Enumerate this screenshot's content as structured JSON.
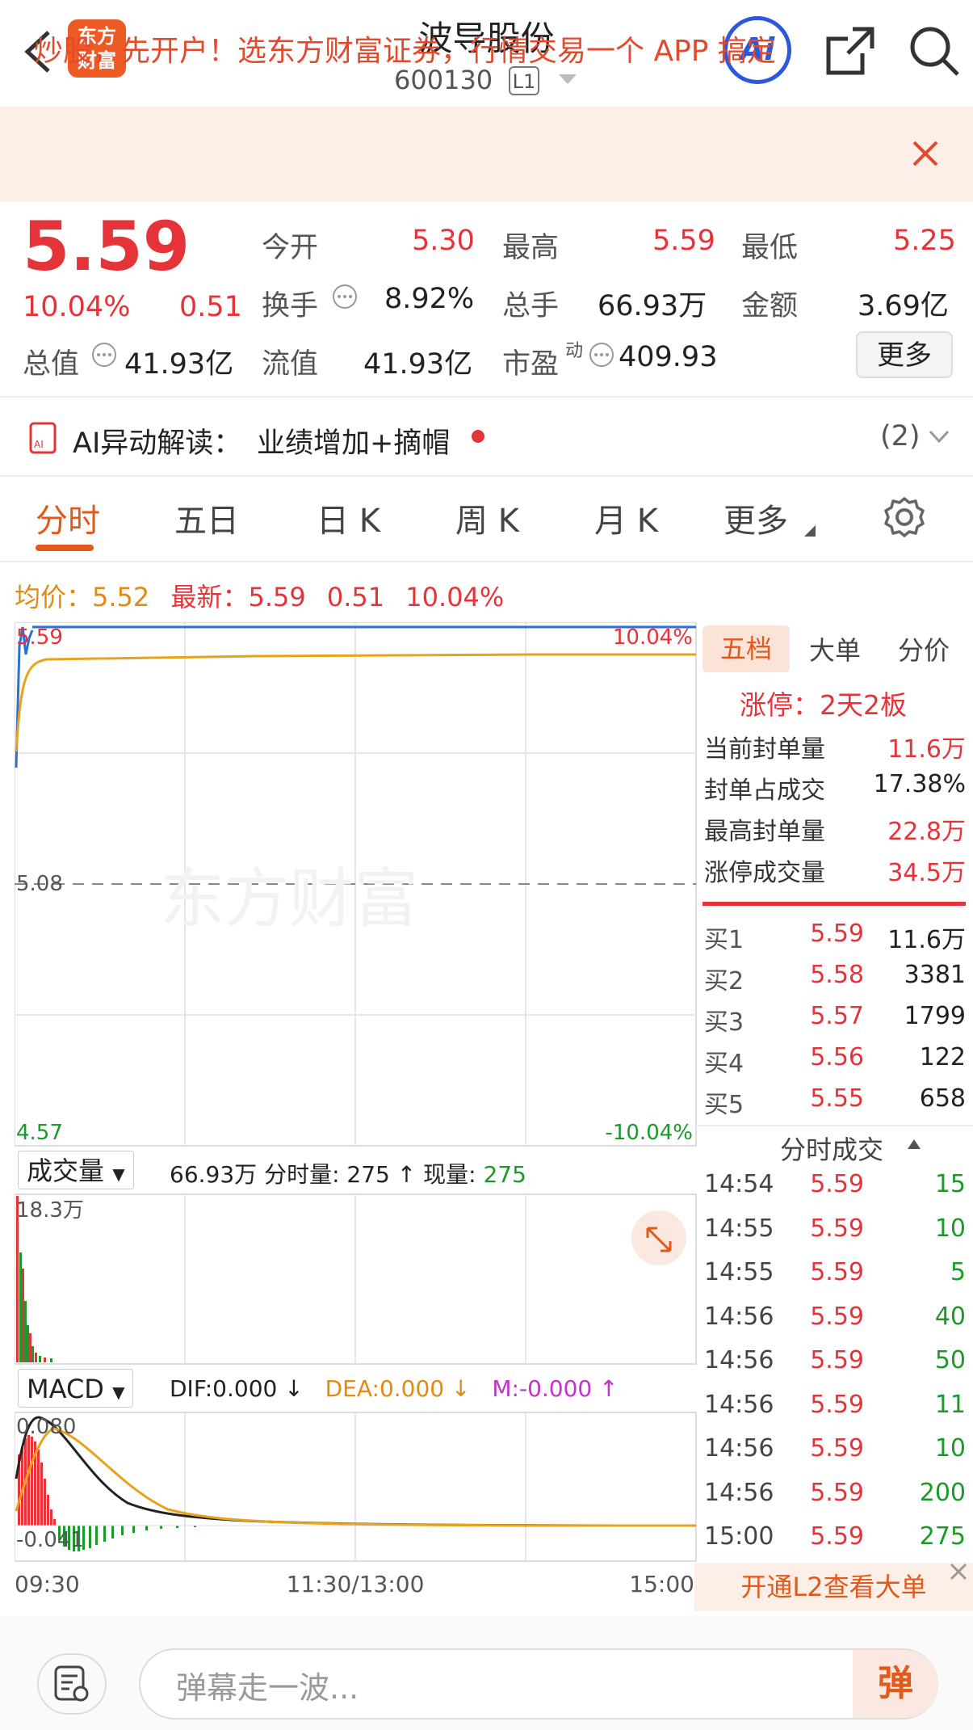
{
  "header": {
    "title": "波导股份",
    "code": "600130",
    "level": "L1",
    "logo_line1": "东方",
    "logo_line2": "财富",
    "ai_label": "Ai"
  },
  "banner": {
    "text": "炒股，先开户！选东方财富证券，行情交易一个 APP 搞定"
  },
  "quote": {
    "price": "5.59",
    "change_pct": "10.04%",
    "change": "0.51",
    "open_label": "今开",
    "open": "5.30",
    "high_label": "最高",
    "high": "5.59",
    "low_label": "最低",
    "low": "5.25",
    "turnover_label": "换手",
    "turnover": "8.92%",
    "volume_label": "总手",
    "volume": "66.93万",
    "amount_label": "金额",
    "amount": "3.69亿",
    "mcap_label": "总值",
    "mcap": "41.93亿",
    "float_label": "流值",
    "float": "41.93亿",
    "pe_label": "市盈",
    "pe_sup": "动",
    "pe": "409.93",
    "more": "更多"
  },
  "ai_insight": {
    "label": "AI异动解读：",
    "text": "业绩增加+摘帽",
    "count": "(2)"
  },
  "tabs": [
    "分时",
    "五日",
    "日 K",
    "周 K",
    "月 K",
    "更多"
  ],
  "info_line": {
    "avg_label": "均价：",
    "avg": "5.52",
    "latest_label": "最新：",
    "latest": "5.59",
    "chg": "0.51",
    "pct": "10.04%"
  },
  "chart_main": {
    "top_price": "5.59",
    "mid_price": "5.08",
    "bottom_price": "4.57",
    "top_pct": "10.04%",
    "bottom_pct": "-10.04%",
    "watermark": "东方财富"
  },
  "volume_panel": {
    "selector": "成交量",
    "total": "66.93万",
    "seg_label": "分时量: 275 ↑",
    "now_label": "现量: ",
    "now": "275",
    "max": "18.3万"
  },
  "macd_panel": {
    "selector": "MACD",
    "dif": "DIF:0.000 ↓",
    "dea": "DEA:0.000 ↓",
    "m": "M:-0.000 ↑",
    "top": "0.080",
    "bottom": "-0.041"
  },
  "time_axis": [
    "09:30",
    "11:30/13:00",
    "15:00"
  ],
  "right_tabs": [
    "五档",
    "大单",
    "分价"
  ],
  "limit": {
    "title": "涨停：2天2板",
    "rows": [
      {
        "label": "当前封单量",
        "value": "11.6万"
      },
      {
        "label": "封单占成交",
        "value": "17.38%"
      },
      {
        "label": "最高封单量",
        "value": "22.8万"
      },
      {
        "label": "涨停成交量",
        "value": "34.5万"
      }
    ]
  },
  "bids": [
    {
      "label": "买1",
      "price": "5.59",
      "vol": "11.6万"
    },
    {
      "label": "买2",
      "price": "5.58",
      "vol": "3381"
    },
    {
      "label": "买3",
      "price": "5.57",
      "vol": "1799"
    },
    {
      "label": "买4",
      "price": "5.56",
      "vol": "122"
    },
    {
      "label": "买5",
      "price": "5.55",
      "vol": "658"
    }
  ],
  "trades_title": "分时成交",
  "trades": [
    {
      "time": "14:54",
      "price": "5.59",
      "vol": "15"
    },
    {
      "time": "14:55",
      "price": "5.59",
      "vol": "10"
    },
    {
      "time": "14:55",
      "price": "5.59",
      "vol": "5"
    },
    {
      "time": "14:56",
      "price": "5.59",
      "vol": "40"
    },
    {
      "time": "14:56",
      "price": "5.59",
      "vol": "50"
    },
    {
      "time": "14:56",
      "price": "5.59",
      "vol": "11"
    },
    {
      "time": "14:56",
      "price": "5.59",
      "vol": "10"
    },
    {
      "time": "14:56",
      "price": "5.59",
      "vol": "200"
    },
    {
      "time": "15:00",
      "price": "5.59",
      "vol": "275"
    }
  ],
  "open_l2": "开通L2查看大单",
  "danmu_placeholder": "弹幕走一波...",
  "danmu_icon": "弹"
}
